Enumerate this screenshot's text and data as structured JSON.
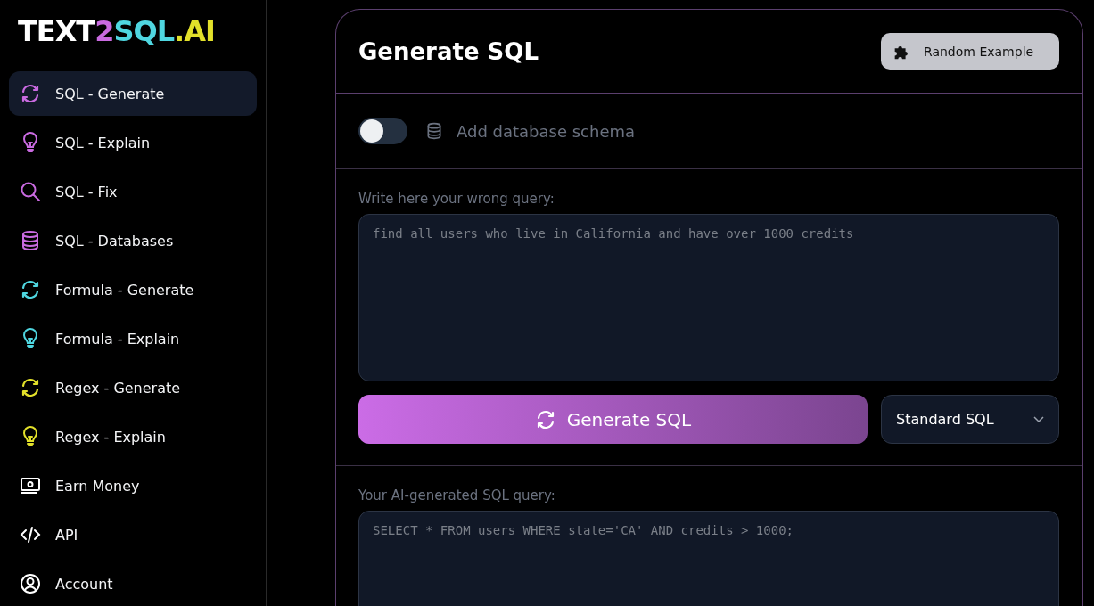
{
  "logo": [
    {
      "text": "TEXT",
      "color": "#ffffff"
    },
    {
      "text": "2",
      "color": "#c96ae0"
    },
    {
      "text": "SQL",
      "color": "#4fd6e0"
    },
    {
      "text": ".AI",
      "color": "#e2e02a"
    }
  ],
  "sidebar": {
    "items": [
      {
        "label": "SQL - Generate",
        "kind": "refresh",
        "color": "#c96ae0",
        "selected": true
      },
      {
        "label": "SQL - Explain",
        "kind": "bulb",
        "color": "#c96ae0",
        "selected": false
      },
      {
        "label": "SQL - Fix",
        "kind": "search",
        "color": "#c96ae0",
        "selected": false
      },
      {
        "label": "SQL - Databases",
        "kind": "database",
        "color": "#c96ae0",
        "selected": false
      },
      {
        "label": "Formula - Generate",
        "kind": "refresh",
        "color": "#4fd6e0",
        "selected": false
      },
      {
        "label": "Formula - Explain",
        "kind": "bulb",
        "color": "#4fd6e0",
        "selected": false
      },
      {
        "label": "Regex - Generate",
        "kind": "refresh",
        "color": "#e2e02a",
        "selected": false
      },
      {
        "label": "Regex - Explain",
        "kind": "bulb",
        "color": "#e2e02a",
        "selected": false
      },
      {
        "label": "Earn Money",
        "kind": "money",
        "color": "#ffffff",
        "selected": false
      },
      {
        "label": "API",
        "kind": "code",
        "color": "#ffffff",
        "selected": false
      },
      {
        "label": "Account",
        "kind": "user",
        "color": "#ffffff",
        "selected": false
      }
    ]
  },
  "card": {
    "title": "Generate SQL",
    "random_button": "Random Example",
    "schema_toggle": {
      "label": "Add database schema",
      "on": false
    },
    "input": {
      "label": "Write here your wrong query:",
      "placeholder": "find all users who live in California and have over 1000 credits"
    },
    "generate_button": "Generate SQL",
    "dialect": {
      "value": "Standard SQL"
    },
    "output": {
      "label": "Your AI-generated SQL query:",
      "placeholder": "SELECT * FROM users WHERE state='CA' AND credits > 1000;"
    }
  }
}
